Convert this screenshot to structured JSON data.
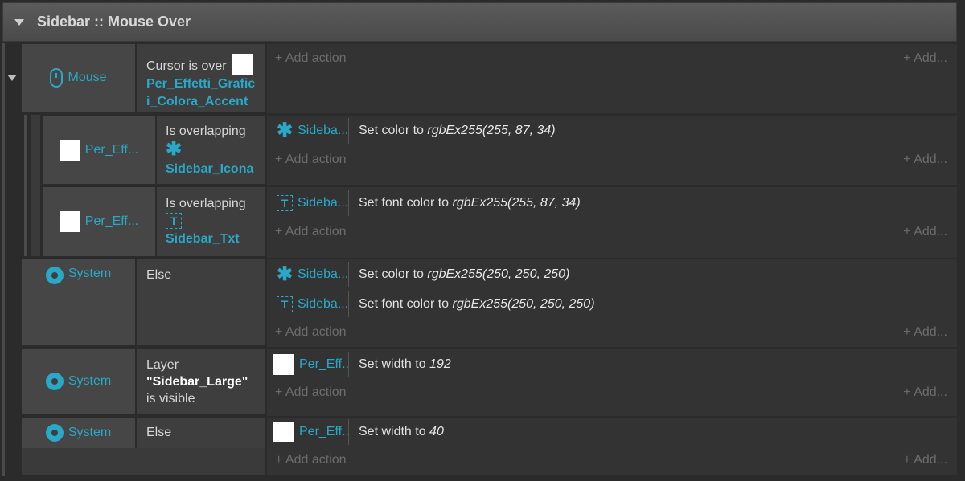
{
  "group": {
    "title": "Sidebar :: Mouse Over"
  },
  "add_action": "+ Add action",
  "add_short": "+ Add...",
  "events": [
    {
      "object_label": "Mouse",
      "cond_prefix": "Cursor is over",
      "cond_ref": "Per_Effetti_Grafici_Colora_Accent"
    },
    {
      "object_label": "Per_Eff...",
      "cond_prefix": "Is overlapping",
      "cond_ref": "Sidebar_Icona",
      "action_obj": "Sideba...",
      "action_text": "Set color to ",
      "action_val": "rgbEx255(255, 87, 34)"
    },
    {
      "object_label": "Per_Eff...",
      "cond_prefix": "Is overlapping",
      "cond_ref": "Sidebar_Txt",
      "action_obj": "Sideba...",
      "action_text": "Set font color to ",
      "action_val": "rgbEx255(255, 87, 34)"
    },
    {
      "object_label": "System",
      "cond_prefix": "Else",
      "actions": [
        {
          "obj": "Sideba...",
          "text": "Set color to ",
          "val": "rgbEx255(250, 250, 250)"
        },
        {
          "obj": "Sideba...",
          "text": "Set font color to ",
          "val": "rgbEx255(250, 250, 250)"
        }
      ]
    },
    {
      "object_label": "System",
      "cond_a": "Layer",
      "cond_q": "\"Sidebar_Large\"",
      "cond_b": " is visible",
      "action_obj": "Per_Eff...",
      "action_text": "Set width to ",
      "action_val": "192"
    },
    {
      "object_label": "System",
      "cond_prefix": "Else",
      "action_obj": "Per_Eff...",
      "action_text": "Set width to ",
      "action_val": "40"
    }
  ]
}
